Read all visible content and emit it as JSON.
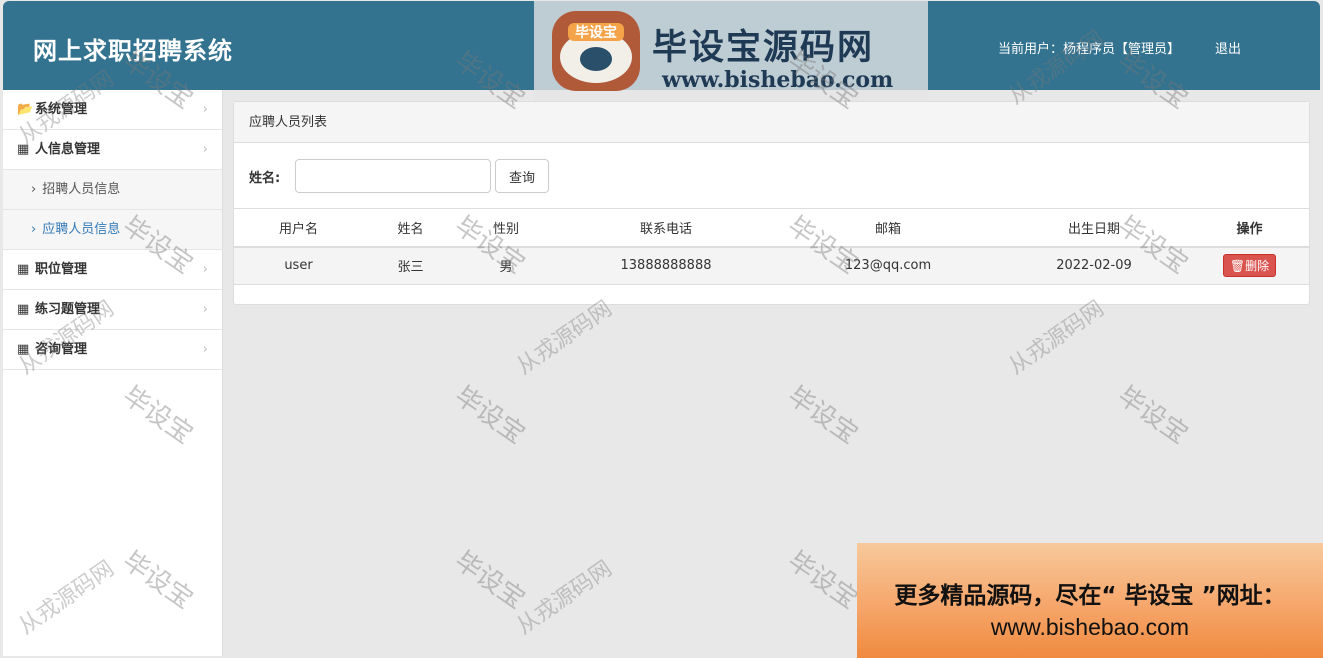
{
  "app": {
    "title": "网上求职招聘系统"
  },
  "header": {
    "current_user_label": "当前用户：杨程序员【管理员】",
    "logout_label": "退出"
  },
  "brand": {
    "title": "毕设宝源码网",
    "url": "www.bishebao.com",
    "logo_text": "毕设宝"
  },
  "sidebar": {
    "items": [
      {
        "label": "系统管理",
        "icon": "folder-open-icon"
      },
      {
        "label": "人信息管理",
        "icon": "grid-icon"
      },
      {
        "label": "招聘人员信息"
      },
      {
        "label": "应聘人员信息"
      },
      {
        "label": "职位管理",
        "icon": "grid-icon"
      },
      {
        "label": "练习题管理",
        "icon": "grid-icon"
      },
      {
        "label": "咨询管理",
        "icon": "grid-icon"
      }
    ]
  },
  "panel": {
    "title": "应聘人员列表"
  },
  "search": {
    "label": "姓名:",
    "value": "",
    "placeholder": "",
    "button_label": "查询"
  },
  "table": {
    "headers": [
      "用户名",
      "姓名",
      "性别",
      "联系电话",
      "邮箱",
      "出生日期",
      "操作"
    ],
    "rows": [
      {
        "username": "user",
        "name": "张三",
        "gender": "男",
        "phone": "13888888888",
        "email": "123@qq.com",
        "birth": "2022-02-09",
        "action": "删除"
      }
    ]
  },
  "watermarks": {
    "main": "毕设宝",
    "secondary": "从戎源码网"
  },
  "promo": {
    "line1": "更多精品源码，尽在“ 毕设宝 ”网址：",
    "line2": "www.bishebao.com"
  },
  "colors": {
    "header_bg": "#337390",
    "accent": "#337ab7",
    "danger": "#d9534f"
  }
}
